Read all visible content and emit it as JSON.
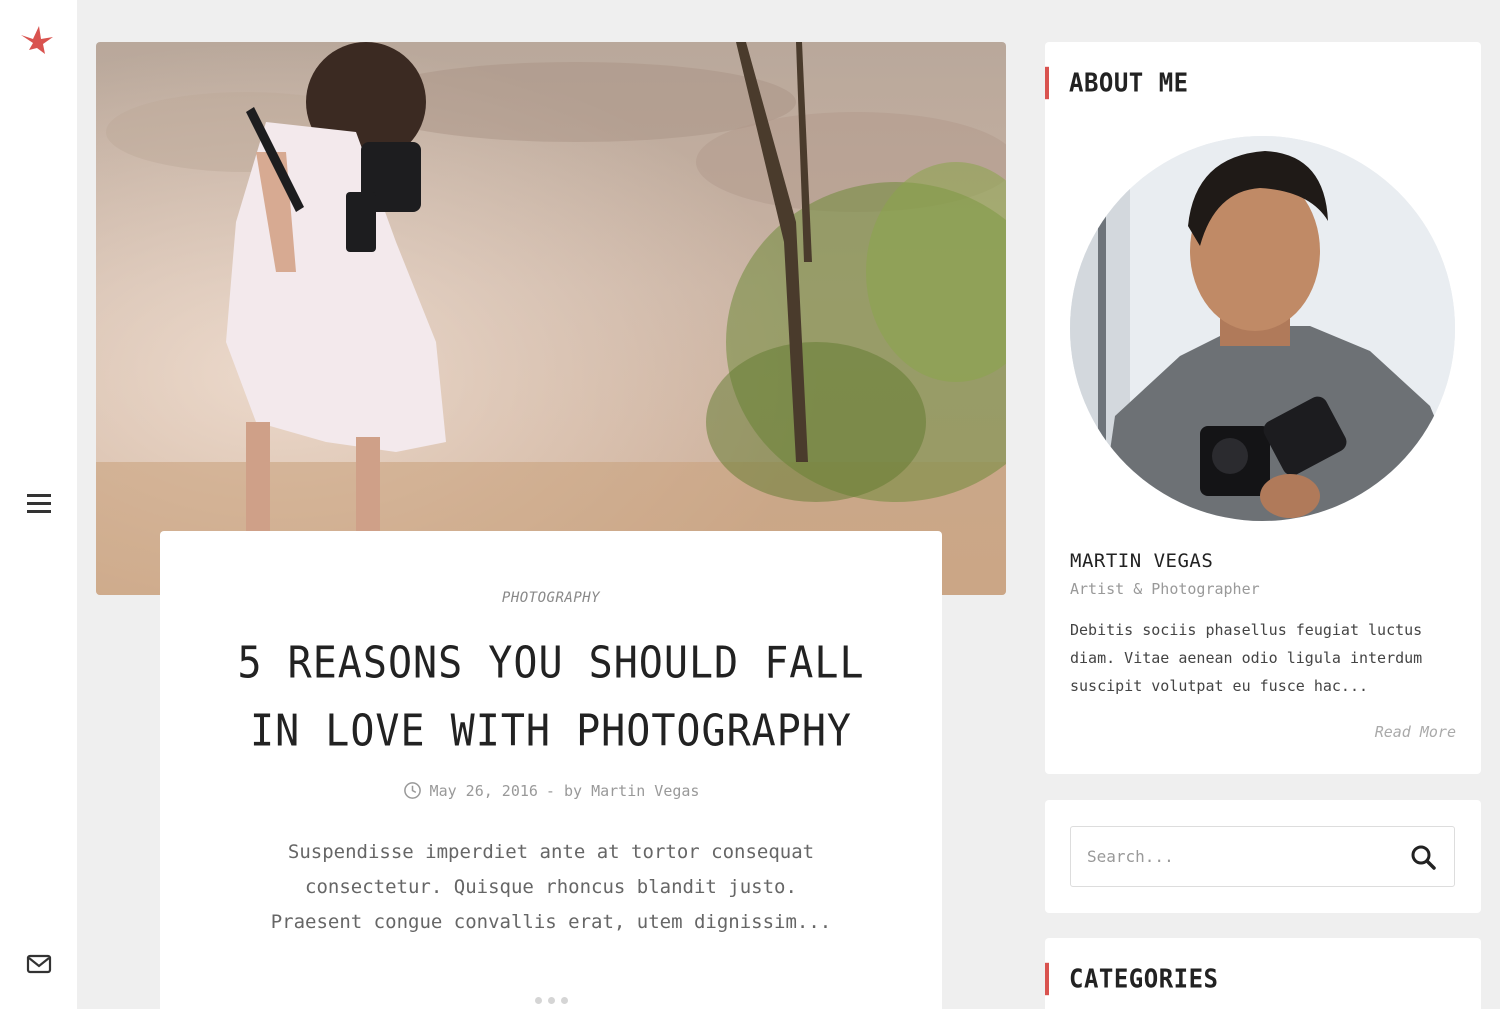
{
  "colors": {
    "accent": "#d9534f",
    "page_background": "#efefef",
    "card_background": "#ffffff",
    "title_text": "#222222",
    "muted_text": "#999999"
  },
  "rail": {
    "logo_icon": "bird-logo-icon",
    "menu_icon": "hamburger-menu-icon",
    "mail_icon": "envelope-icon"
  },
  "post": {
    "image": "girl-with-camera-photo",
    "category": "PHOTOGRAPHY",
    "title_line1": "5 REASONS YOU SHOULD FALL",
    "title_line2": "IN LOVE WITH PHOTOGRAPHY",
    "date": "May 26, 2016",
    "byline": "- by Martin Vegas",
    "excerpt": "Suspendisse imperdiet ante at tortor consequat consectetur. Quisque rhoncus blandit justo. Praesent congue convallis erat, utem dignissim..."
  },
  "about": {
    "heading": "ABOUT ME",
    "avatar": "man-with-camera-photo",
    "name": "MARTIN VEGAS",
    "role": "Artist & Photographer",
    "bio": "Debitis sociis phasellus feugiat luctus diam. Vitae aenean odio ligula interdum suscipit volutpat eu fusce hac...",
    "read_more": "Read More"
  },
  "search": {
    "placeholder": "Search..."
  },
  "categories": {
    "heading": "CATEGORIES"
  }
}
